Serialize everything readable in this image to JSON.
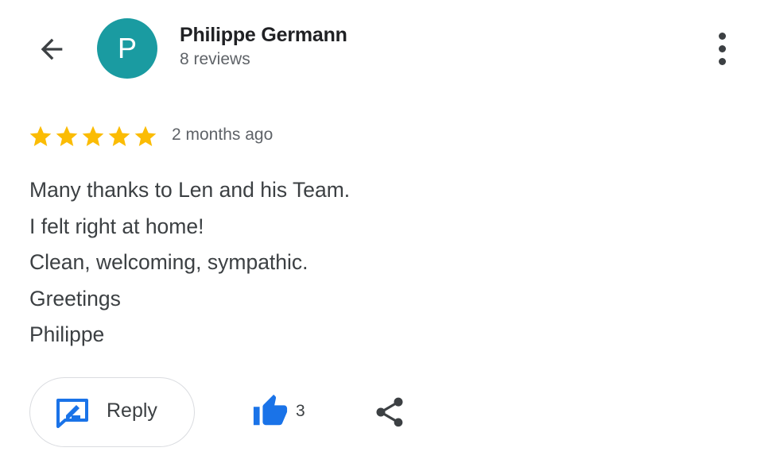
{
  "reviewer": {
    "initial": "P",
    "avatar_color": "#1a9ba1",
    "name": "Philippe Germann",
    "review_count": "8 reviews"
  },
  "icons": {
    "back": "arrow-left-icon",
    "more": "more-vert-icon",
    "star": "star-icon",
    "reply": "rate-review-icon",
    "like": "thumb-up-icon",
    "share": "share-icon"
  },
  "review": {
    "rating": 5,
    "rating_max": 5,
    "star_color": "#fbbc04",
    "time": "2 months ago",
    "lines": [
      "Many thanks to Len and his Team.",
      "I felt right at home!",
      "Clean, welcoming, sympathic.",
      "Greetings",
      "Philippe"
    ]
  },
  "actions": {
    "reply_label": "Reply",
    "like_count": "3",
    "accent_color": "#1a73e8"
  }
}
